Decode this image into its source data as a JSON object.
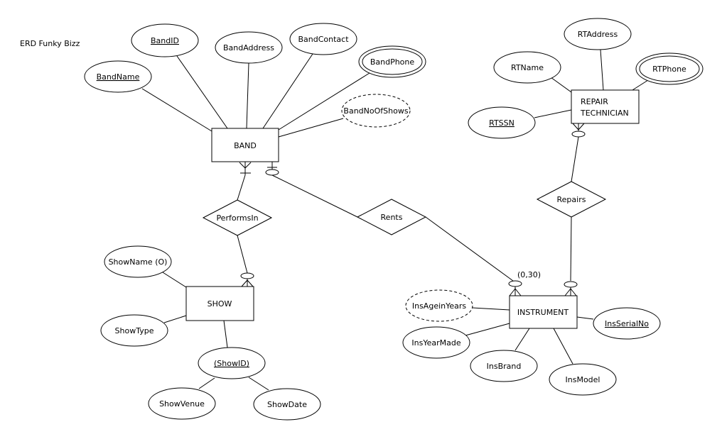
{
  "title": "ERD Funky Bizz",
  "entities": {
    "band": "BAND",
    "repair_technician_line1": "REPAIR",
    "repair_technician_line2": "TECHNICIAN",
    "show": "SHOW",
    "instrument": "INSTRUMENT"
  },
  "relationships": {
    "performs_in": "PerformsIn",
    "rents": "Rents",
    "repairs": "Repairs"
  },
  "attributes": {
    "band_id": "BandID",
    "band_name": "BandName",
    "band_address": "BandAddress",
    "band_contact": "BandContact",
    "band_phone": "BandPhone",
    "band_no_of_shows": "BandNoOfShows",
    "rt_address": "RTAddress",
    "rt_name": "RTName",
    "rt_phone": "RTPhone",
    "rt_ssn": "RTSSN",
    "show_name": "ShowName (O)",
    "show_type": "ShowType",
    "show_id": "(ShowID)",
    "show_venue": "ShowVenue",
    "show_date": "ShowDate",
    "ins_age": "InsAgeinYears",
    "ins_year_made": "InsYearMade",
    "ins_brand": "InsBrand",
    "ins_model": "InsModel",
    "ins_serial_no": "InsSerialNo"
  },
  "cardinality_label": "(0,30)"
}
